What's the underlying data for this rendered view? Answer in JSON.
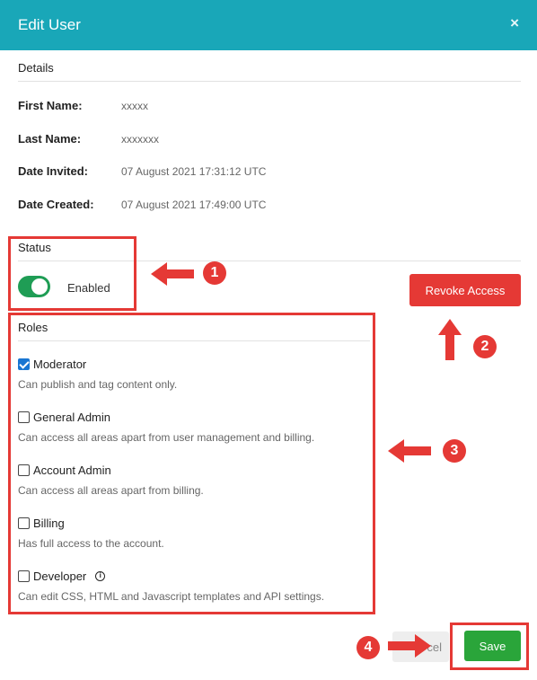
{
  "header": {
    "title": "Edit User",
    "close_symbol": "×"
  },
  "details": {
    "heading": "Details",
    "fields": [
      {
        "label": "First Name:",
        "value": "xxxxx"
      },
      {
        "label": "Last Name:",
        "value": "xxxxxxx"
      },
      {
        "label": "Date Invited:",
        "value": "07 August 2021 17:31:12 UTC"
      },
      {
        "label": "Date Created:",
        "value": "07 August 2021 17:49:00 UTC"
      }
    ]
  },
  "status": {
    "heading": "Status",
    "toggle_label": "Enabled",
    "enabled": true
  },
  "revoke": {
    "label": "Revoke Access"
  },
  "roles": {
    "heading": "Roles",
    "items": [
      {
        "name": "Moderator",
        "desc": "Can publish and tag content only.",
        "checked": true
      },
      {
        "name": "General Admin",
        "desc": "Can access all areas apart from user management and billing.",
        "checked": false
      },
      {
        "name": "Account Admin",
        "desc": "Can access all areas apart from billing.",
        "checked": false
      },
      {
        "name": "Billing",
        "desc": "Has full access to the account.",
        "checked": false
      },
      {
        "name": "Developer",
        "desc": "Can edit CSS, HTML and Javascript templates and API settings.",
        "checked": false,
        "has_info": true
      }
    ]
  },
  "footer": {
    "cancel_label": "cel",
    "save_label": "Save"
  },
  "annotations": {
    "badges": [
      "1",
      "2",
      "3",
      "4"
    ],
    "color": "#e53935"
  },
  "colors": {
    "header": "#19a7b8",
    "toggle": "#1f9d55",
    "save": "#2aa53a",
    "revoke": "#e53935",
    "checkbox": "#1976d2"
  }
}
